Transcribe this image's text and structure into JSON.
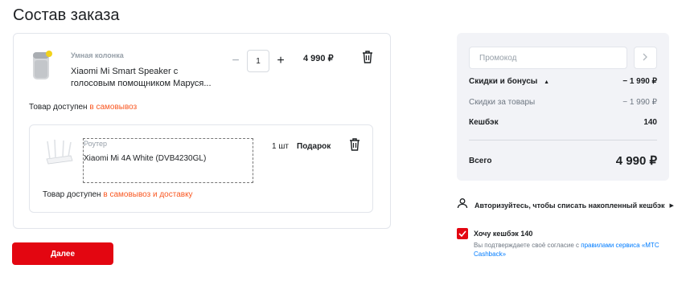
{
  "page": {
    "title": "Состав заказа"
  },
  "item1": {
    "category": "Умная колонка",
    "name": "Xiaomi Mi Smart Speaker с голосовым помощником Маруся...",
    "qty": "1",
    "minus": "−",
    "plus": "+",
    "price": "4 990 ₽",
    "availability_prefix": "Товар доступен",
    "availability_link": "в самовывоз"
  },
  "item2": {
    "category": "Роутер",
    "name": "Xiaomi Mi 4A White (DVB4230GL)",
    "qty": "1 шт",
    "price": "Подарок",
    "availability_prefix": "Товар доступен",
    "availability_link": "в самовывоз и доставку"
  },
  "next_button": "Далее",
  "summary": {
    "promo_placeholder": "Промокод",
    "discounts_label": "Скидки и бонусы",
    "discounts_value": "− 1 990 ₽",
    "goods_discount_label": "Скидки за товары",
    "goods_discount_value": "− 1 990 ₽",
    "cashback_label": "Кешбэк",
    "cashback_value": "140",
    "total_label": "Всего",
    "total_value": "4 990 ₽"
  },
  "auth": {
    "text": "Авторизуйтесь, чтобы списать накопленный кешбэк"
  },
  "cashback_opt": {
    "label": "Хочу кешбэк 140",
    "note_prefix": "Вы подтверждаете своё согласие с",
    "note_link": "правилами сервиса «МТС Cashback»"
  },
  "colors": {
    "accent": "#e30611",
    "link_orange": "#f95721",
    "link_blue": "#007cff",
    "panel": "#f2f3f7"
  }
}
